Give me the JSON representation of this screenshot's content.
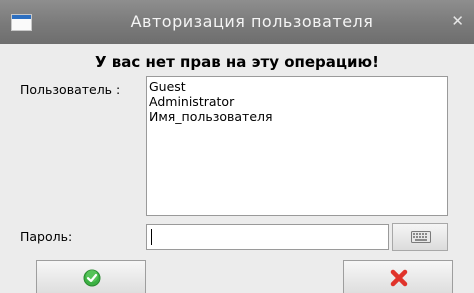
{
  "window": {
    "title": "Авторизация пользователя"
  },
  "heading": "У вас нет прав на эту операцию!",
  "user_field": {
    "label": "Пользователь :",
    "items": [
      "Guest",
      "Administrator",
      "Имя_пользователя"
    ]
  },
  "password_field": {
    "label": "Пароль:",
    "value": ""
  },
  "icons": {
    "app": "window-icon",
    "close": "close-icon",
    "keyboard": "keyboard-icon",
    "ok": "green-check-icon",
    "cancel": "red-x-icon"
  },
  "colors": {
    "titlebar": "#7a7a7a",
    "ok_icon": "#3cb043",
    "cancel_icon": "#e0332b"
  }
}
